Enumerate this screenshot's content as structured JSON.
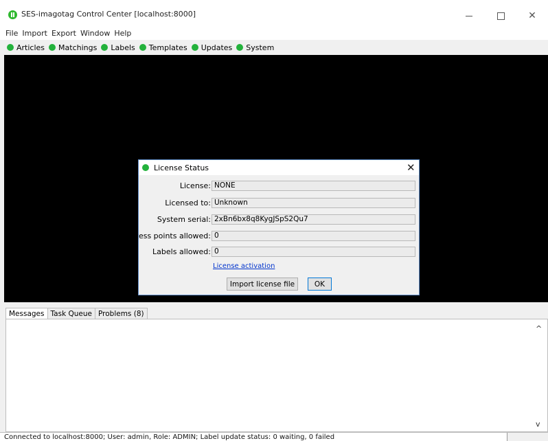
{
  "window": {
    "title": "SES-imagotag Control Center [localhost:8000]",
    "minimize_glyph": "",
    "close_glyph": "✕"
  },
  "menu": [
    "File",
    "Import",
    "Export",
    "Window",
    "Help"
  ],
  "toolbar": {
    "status_color": "#23b23c",
    "items": [
      "Articles",
      "Matchings",
      "Labels",
      "Templates",
      "Updates",
      "System"
    ]
  },
  "dialog": {
    "title": "License Status",
    "close_glyph": "✕",
    "fields": [
      {
        "label": "License:",
        "value": "NONE"
      },
      {
        "label": "Licensed to:",
        "value": "Unknown"
      },
      {
        "label": "System serial:",
        "value": "2xBn6bx8q8KygJSpS2Qu7"
      },
      {
        "label": "Access points allowed:",
        "value": "0"
      },
      {
        "label": "Labels allowed:",
        "value": "0"
      }
    ],
    "link": "License activation",
    "import_button": "Import license file",
    "ok_button": "OK"
  },
  "tabs": [
    "Messages",
    "Task Queue",
    "Problems (8)"
  ],
  "scroll": {
    "up_glyph": "^",
    "down_glyph": "v"
  },
  "status": {
    "text": "Connected to localhost:8000; User: admin, Role: ADMIN; Label update status: 0 waiting, 0 failed"
  }
}
